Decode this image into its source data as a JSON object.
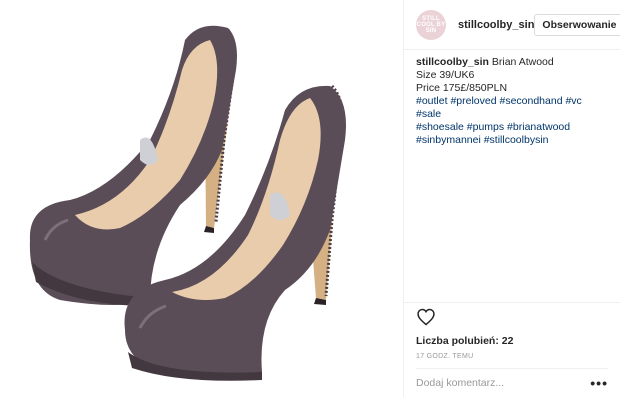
{
  "post": {
    "image_alt": "Brian Atwood grey leather platform pumps",
    "colors": {
      "shoe": "#5a4d57",
      "insole": "#e8ccac",
      "heel": "#d4b083"
    }
  },
  "header": {
    "avatar_text": "STILL COOL BY SIN",
    "username": "stillcoolby_sin",
    "follow_label": "Obserwowanie"
  },
  "caption": {
    "username": "stillcoolby_sin",
    "lines": [
      "Brian Atwood",
      "Size 39/UK6",
      "Price 175£/850PLN"
    ],
    "hashtags_lines": [
      "#outlet #preloved #secondhand #vc #sale",
      "#shoesale #pumps #brianatwood",
      "#sinbymannei #stillcoolbysin"
    ]
  },
  "actions": {
    "heart_icon": "heart-outline-icon",
    "likes_text": "Liczba polubień: 22",
    "time_text": "17 GODZ. TEMU"
  },
  "comment": {
    "placeholder": "Dodaj komentarz...",
    "more_label": "•••"
  }
}
